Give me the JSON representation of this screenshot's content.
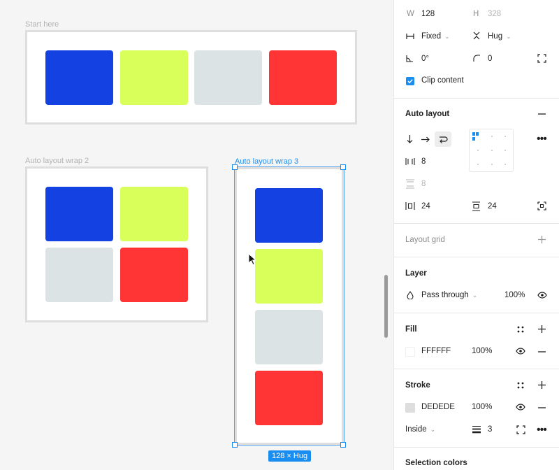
{
  "canvas": {
    "frames": [
      {
        "label": "Start here",
        "selected": false
      },
      {
        "label": "Auto layout wrap 2",
        "selected": false
      },
      {
        "label": "Auto layout wrap 3",
        "selected": true
      }
    ],
    "swatch_colors": {
      "blue": "#1441e1",
      "lime": "#d8ff5a",
      "gray": "#dce3e5",
      "red": "#ff3535"
    },
    "size_badge": "128 × Hug"
  },
  "panel": {
    "dimensions": {
      "w_label": "W",
      "w_value": "128",
      "h_label": "H",
      "h_value": "328"
    },
    "resizing": {
      "horizontal": "Fixed",
      "vertical": "Hug"
    },
    "rotation": "0°",
    "corner_radius": "0",
    "clip_content": {
      "label": "Clip content",
      "checked": true
    },
    "auto_layout": {
      "title": "Auto layout",
      "gap_horizontal": "8",
      "gap_vertical": "8",
      "padding_horizontal": "24",
      "padding_vertical": "24"
    },
    "layout_grid": {
      "title": "Layout grid"
    },
    "layer": {
      "title": "Layer",
      "blend_mode": "Pass through",
      "opacity": "100%"
    },
    "fill": {
      "title": "Fill",
      "hex": "FFFFFF",
      "opacity": "100%",
      "color": "#ffffff"
    },
    "stroke": {
      "title": "Stroke",
      "hex": "DEDEDE",
      "opacity": "100%",
      "color": "#dedede",
      "position": "Inside",
      "weight": "3"
    },
    "selection_colors": {
      "title": "Selection colors"
    }
  },
  "accent_color": "#1a8ef0"
}
